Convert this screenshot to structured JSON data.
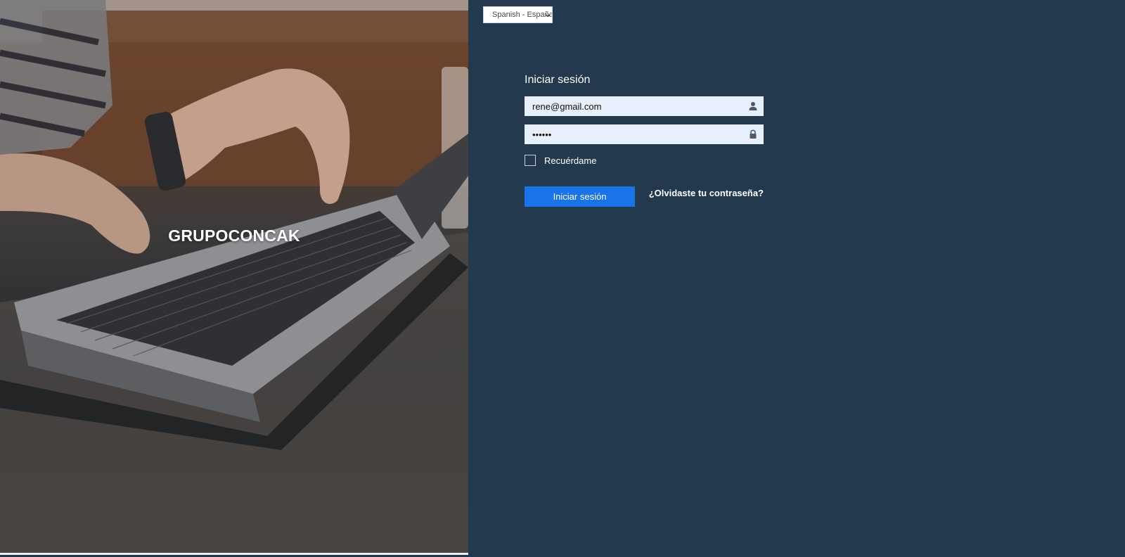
{
  "brand": {
    "name": "GRUPOCONCAK"
  },
  "language": {
    "selected": "Spanish - España"
  },
  "login": {
    "title": "Iniciar sesión",
    "email_value": "rene@gmail.com",
    "password_value": "••••••",
    "remember_label": "Recuérdame",
    "submit_label": "Iniciar sesión",
    "forgot_label": "¿Olvidaste tu contraseña?"
  },
  "icons": {
    "email": "user-icon",
    "password": "lock-icon",
    "language": "chevron-down-icon"
  },
  "colors": {
    "panel_background": "#233a4e",
    "primary_button": "#1a73e8",
    "field_background": "#e8f0fe"
  }
}
